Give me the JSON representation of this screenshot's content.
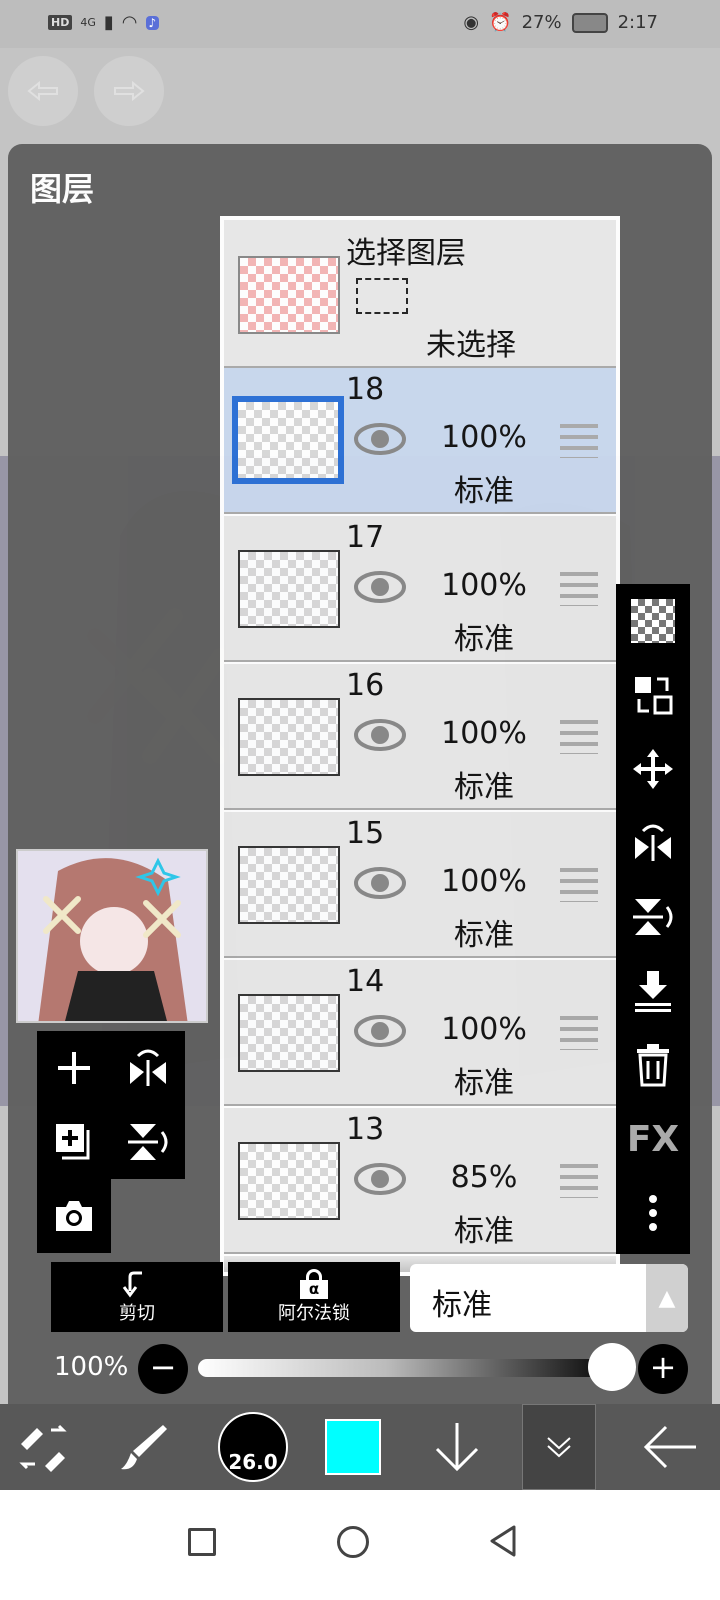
{
  "statusbar": {
    "hd": "HD",
    "signal": "4G",
    "battery": "27%",
    "time": "2:17"
  },
  "panel": {
    "title": "图层"
  },
  "selection_layer": {
    "title": "选择图层",
    "status": "未选择"
  },
  "layers": [
    {
      "number": "18",
      "opacity": "100%",
      "blend": "标准",
      "active": true
    },
    {
      "number": "17",
      "opacity": "100%",
      "blend": "标准",
      "active": false
    },
    {
      "number": "16",
      "opacity": "100%",
      "blend": "标准",
      "active": false
    },
    {
      "number": "15",
      "opacity": "100%",
      "blend": "标准",
      "active": false
    },
    {
      "number": "14",
      "opacity": "100%",
      "blend": "标准",
      "active": false
    },
    {
      "number": "13",
      "opacity": "85%",
      "blend": "标准",
      "active": false
    }
  ],
  "right_toolbar": {
    "fx": "FX"
  },
  "actions": {
    "cut": "剪切",
    "alpha_lock": "阿尔法锁",
    "alpha_symbol": "α"
  },
  "blend_mode": {
    "value": "标准"
  },
  "opacity_slider": {
    "label": "100%",
    "value": 1.0
  },
  "bottom_toolbar": {
    "brush_size": "26.0",
    "color": "#00ffff"
  },
  "colors": {
    "accent": "#2a6fd6",
    "active_row": "#c9d8ee"
  }
}
